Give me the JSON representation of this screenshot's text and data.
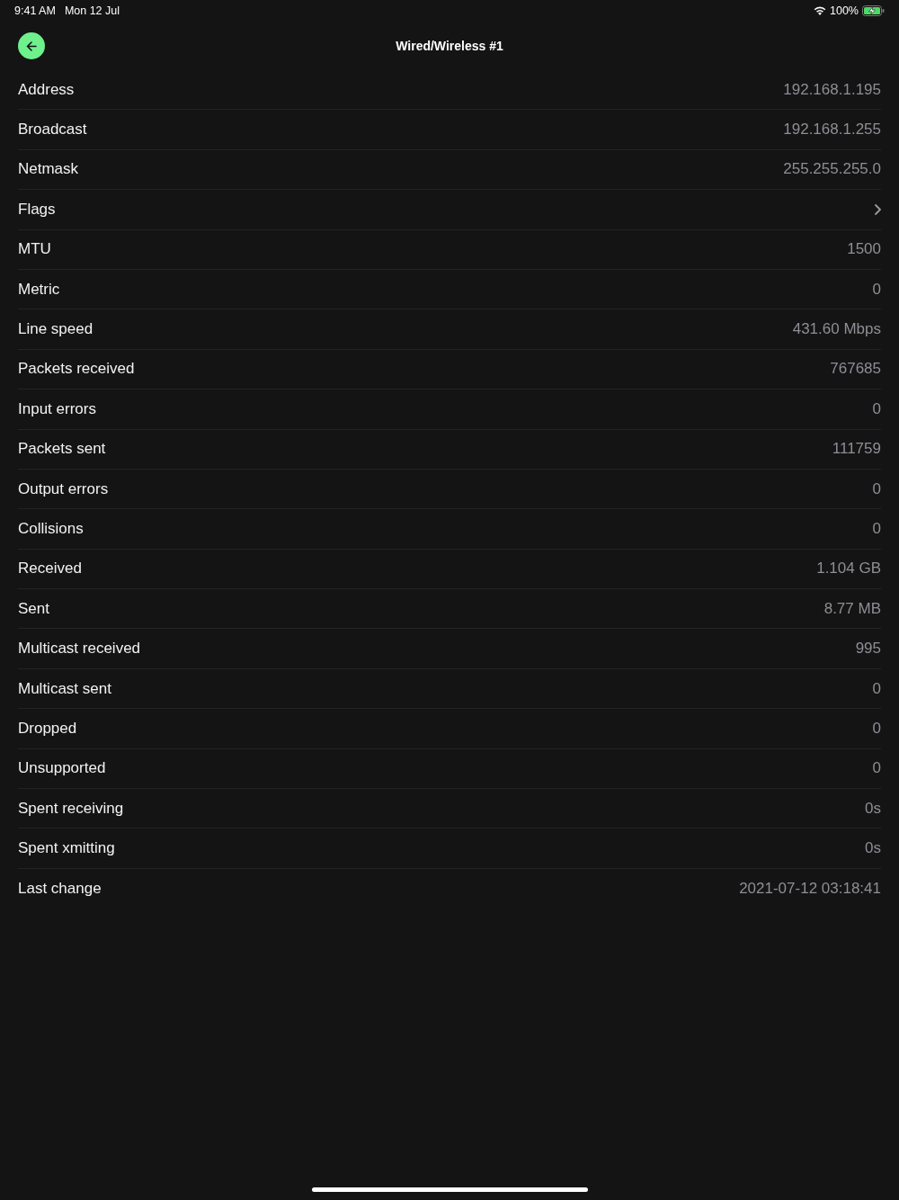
{
  "status_bar": {
    "time": "9:41 AM",
    "date": "Mon 12 Jul",
    "battery": "100%"
  },
  "header": {
    "title": "Wired/Wireless #1"
  },
  "rows": [
    {
      "kind": "value",
      "label": "Address",
      "value": "192.168.1.195"
    },
    {
      "kind": "value",
      "label": "Broadcast",
      "value": "192.168.1.255"
    },
    {
      "kind": "value",
      "label": "Netmask",
      "value": "255.255.255.0"
    },
    {
      "kind": "link",
      "label": "Flags"
    },
    {
      "kind": "value",
      "label": "MTU",
      "value": "1500"
    },
    {
      "kind": "value",
      "label": "Metric",
      "value": "0"
    },
    {
      "kind": "value",
      "label": "Line speed",
      "value": "431.60 Mbps"
    },
    {
      "kind": "value",
      "label": "Packets received",
      "value": "767685"
    },
    {
      "kind": "value",
      "label": "Input errors",
      "value": "0"
    },
    {
      "kind": "value",
      "label": "Packets sent",
      "value": "111759"
    },
    {
      "kind": "value",
      "label": "Output errors",
      "value": "0"
    },
    {
      "kind": "value",
      "label": "Collisions",
      "value": "0"
    },
    {
      "kind": "value",
      "label": "Received",
      "value": "1.104 GB"
    },
    {
      "kind": "value",
      "label": "Sent",
      "value": "8.77 MB"
    },
    {
      "kind": "value",
      "label": "Multicast received",
      "value": "995"
    },
    {
      "kind": "value",
      "label": "Multicast sent",
      "value": "0"
    },
    {
      "kind": "value",
      "label": "Dropped",
      "value": "0"
    },
    {
      "kind": "value",
      "label": "Unsupported",
      "value": "0"
    },
    {
      "kind": "value",
      "label": "Spent receiving",
      "value": "0s"
    },
    {
      "kind": "value",
      "label": "Spent xmitting",
      "value": "0s"
    },
    {
      "kind": "value",
      "label": "Last change",
      "value": "2021-07-12 03:18:41"
    }
  ]
}
